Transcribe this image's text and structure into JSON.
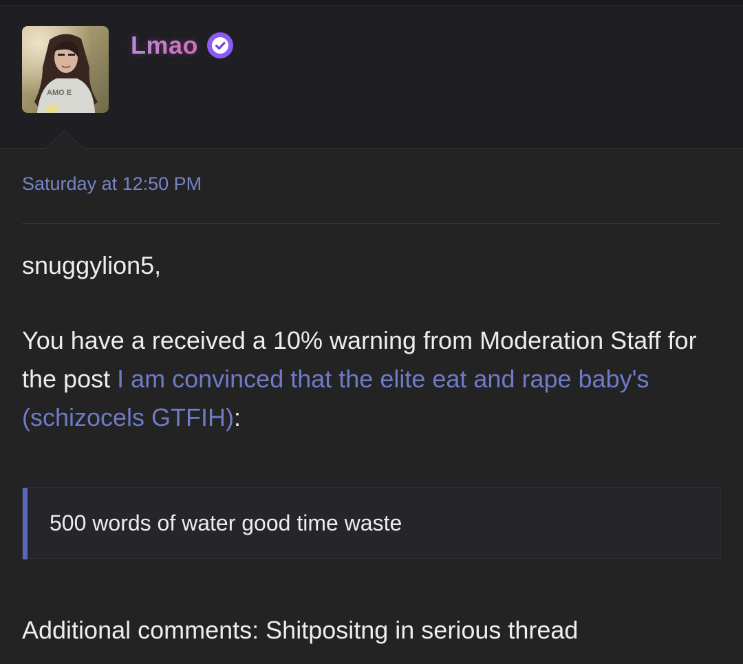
{
  "post": {
    "author": {
      "name": "Lmao",
      "verified": true
    },
    "timestamp": "Saturday at 12:50 PM",
    "greeting": "snuggylion5,",
    "warning": {
      "text_before": "You have a received a 10% warning from Moderation Staff for the post ",
      "thread_link": "I am convinced that the elite eat and rape baby's (schizocels GTFIH)",
      "text_after": ":"
    },
    "quote": "500 words of water good time waste",
    "additional_comments": "Additional comments: Shitpositng in serious thread"
  },
  "colors": {
    "background": "#232323",
    "header_background": "#1f1e23",
    "link": "#6f7bc9",
    "timestamp": "#7884c8",
    "verified_badge": "#8a5cf5",
    "quote_bar": "#5b66bd",
    "username_gradient": [
      "#b78ce0",
      "#d66fb0"
    ]
  },
  "icons": {
    "verified": "verified-check-icon"
  }
}
